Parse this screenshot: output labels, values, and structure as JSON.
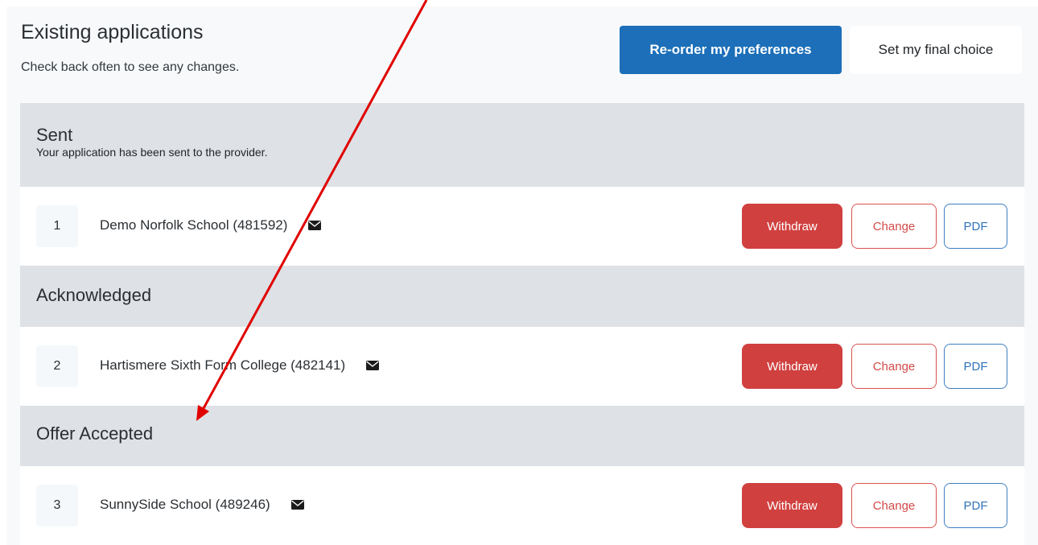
{
  "header": {
    "title": "Existing applications",
    "subtitle": "Check back often to see any changes.",
    "reorder_label": "Re-order my preferences",
    "final_choice_label": "Set my final choice"
  },
  "groups": [
    {
      "title": "Sent",
      "description": "Your application has been sent to the provider.",
      "application": {
        "rank": "1",
        "school": "Demo Norfolk School (481592)"
      }
    },
    {
      "title": "Acknowledged",
      "application": {
        "rank": "2",
        "school": "Hartismere Sixth Form College (482141)"
      }
    },
    {
      "title": "Offer Accepted",
      "application": {
        "rank": "3",
        "school": "SunnySide School (489246)"
      }
    }
  ],
  "actions": {
    "withdraw_label": "Withdraw",
    "change_label": "Change",
    "pdf_label": "PDF"
  },
  "colors": {
    "primary": "#1c6fb8",
    "danger": "#d0403f",
    "group_header_bg": "#dee1e5",
    "annotation_arrow": "#e00000"
  },
  "icons": {
    "message": "envelope-icon",
    "annotation": "arrow-annotation"
  }
}
